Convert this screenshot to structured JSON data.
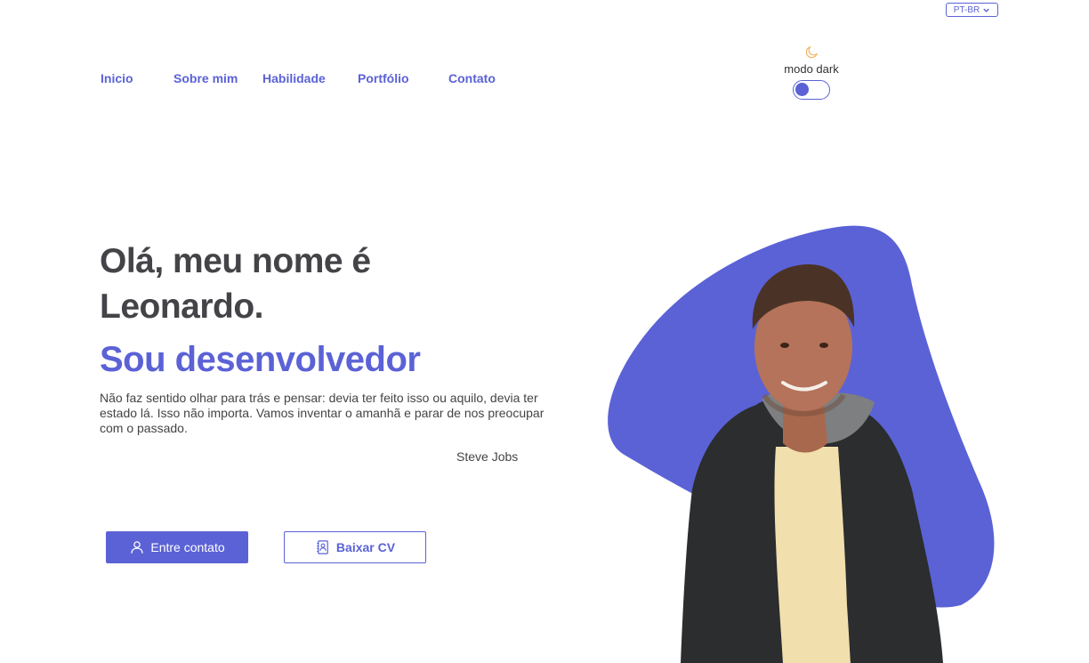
{
  "language": {
    "selected": "PT-BR"
  },
  "nav": {
    "items": [
      "Inicio",
      "Sobre mim",
      "Habilidade",
      "Portfólio",
      "Contato"
    ]
  },
  "dark_mode": {
    "label": "modo dark",
    "enabled": false,
    "icon": "moon-icon"
  },
  "hero": {
    "greeting_line1": "Olá, meu nome é",
    "greeting_line2": "Leonardo.",
    "role": "Sou desenvolvedor",
    "quote": "Não faz sentido olhar para trás e pensar: devia ter feito isso ou aquilo, devia ter estado lá. Isso não importa. Vamos inventar o amanhã e parar de nos preocupar com o passado.",
    "quote_author": "Steve Jobs"
  },
  "buttons": {
    "contact": {
      "label": "Entre contato",
      "icon": "user-icon"
    },
    "cv": {
      "label": "Baixar CV",
      "icon": "contact-book-icon"
    }
  },
  "colors": {
    "accent": "#5b62d6",
    "text_dark": "#444448",
    "moon": "#f2b35c"
  }
}
